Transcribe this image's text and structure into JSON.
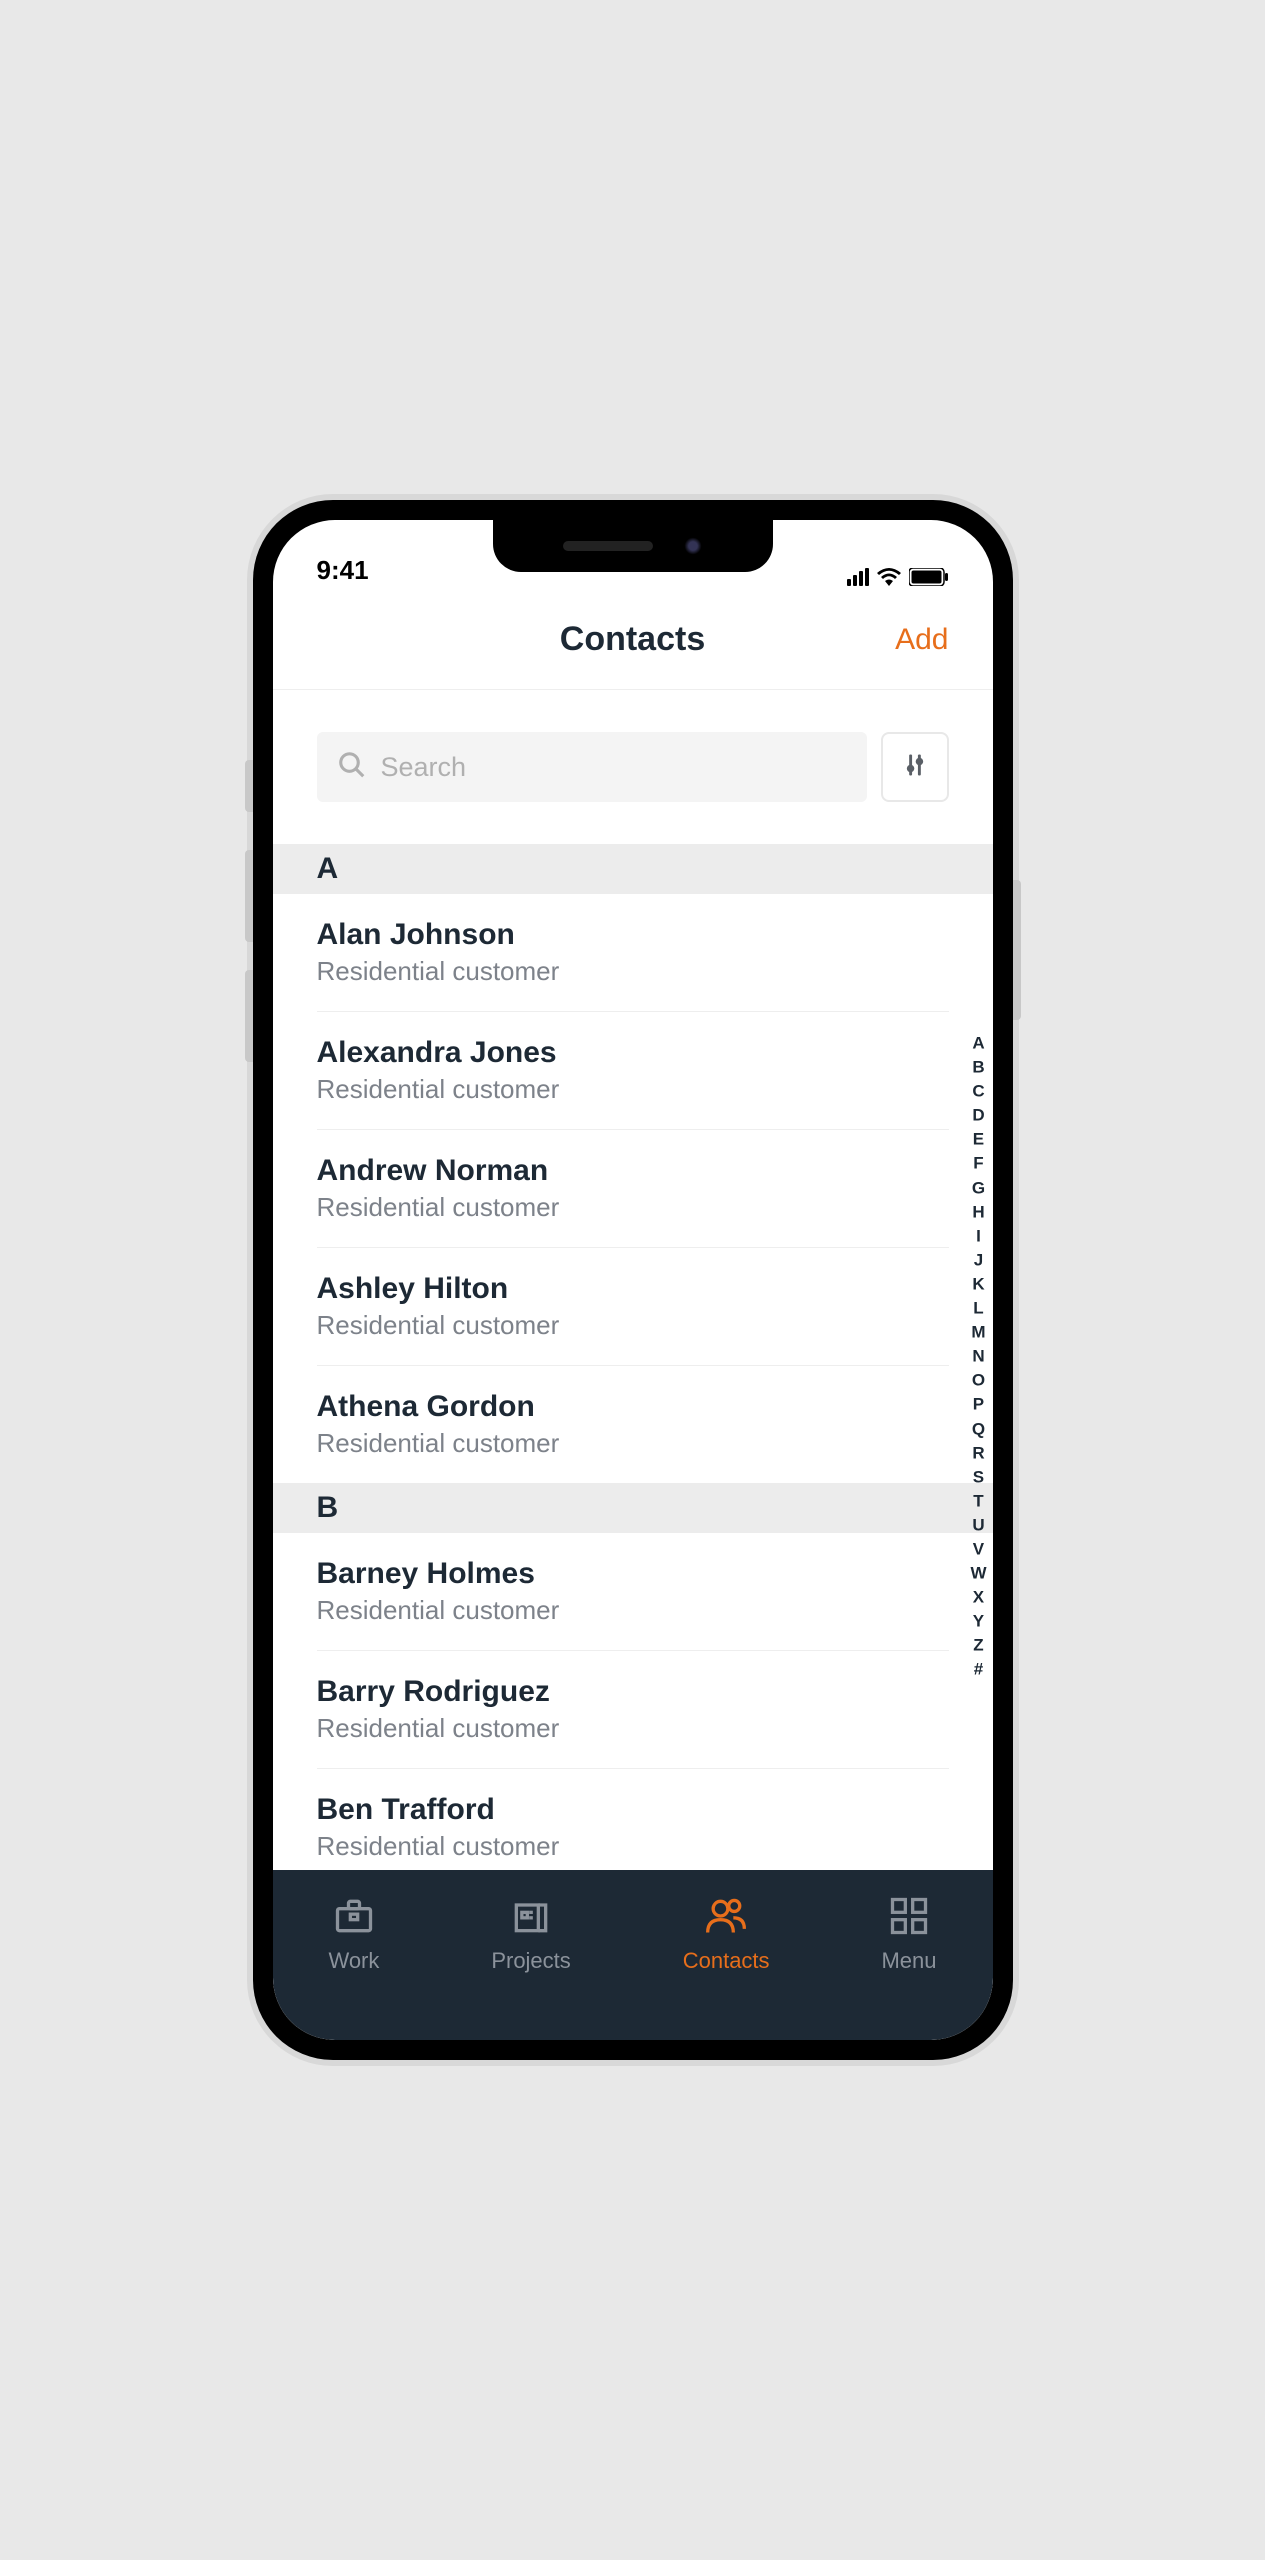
{
  "status": {
    "time": "9:41"
  },
  "header": {
    "title": "Contacts",
    "addLabel": "Add"
  },
  "search": {
    "placeholder": "Search"
  },
  "sections": [
    {
      "letter": "A",
      "contacts": [
        {
          "name": "Alan Johnson",
          "type": "Residential customer"
        },
        {
          "name": "Alexandra Jones",
          "type": "Residential customer"
        },
        {
          "name": "Andrew Norman",
          "type": "Residential customer"
        },
        {
          "name": "Ashley Hilton",
          "type": "Residential customer"
        },
        {
          "name": "Athena Gordon",
          "type": "Residential customer"
        }
      ]
    },
    {
      "letter": "B",
      "contacts": [
        {
          "name": "Barney Holmes",
          "type": "Residential customer"
        },
        {
          "name": "Barry Rodriguez",
          "type": "Residential customer"
        },
        {
          "name": "Ben Trafford",
          "type": "Residential customer"
        }
      ]
    }
  ],
  "alphaIndex": [
    "A",
    "B",
    "C",
    "D",
    "E",
    "F",
    "G",
    "H",
    "I",
    "J",
    "K",
    "L",
    "M",
    "N",
    "O",
    "P",
    "Q",
    "R",
    "S",
    "T",
    "U",
    "V",
    "W",
    "X",
    "Y",
    "Z",
    "#"
  ],
  "tabs": [
    {
      "label": "Work",
      "active": false
    },
    {
      "label": "Projects",
      "active": false
    },
    {
      "label": "Contacts",
      "active": true
    },
    {
      "label": "Menu",
      "active": false
    }
  ],
  "colors": {
    "accent": "#e76e1b",
    "dark": "#1d2935",
    "muted": "#7d828a"
  }
}
